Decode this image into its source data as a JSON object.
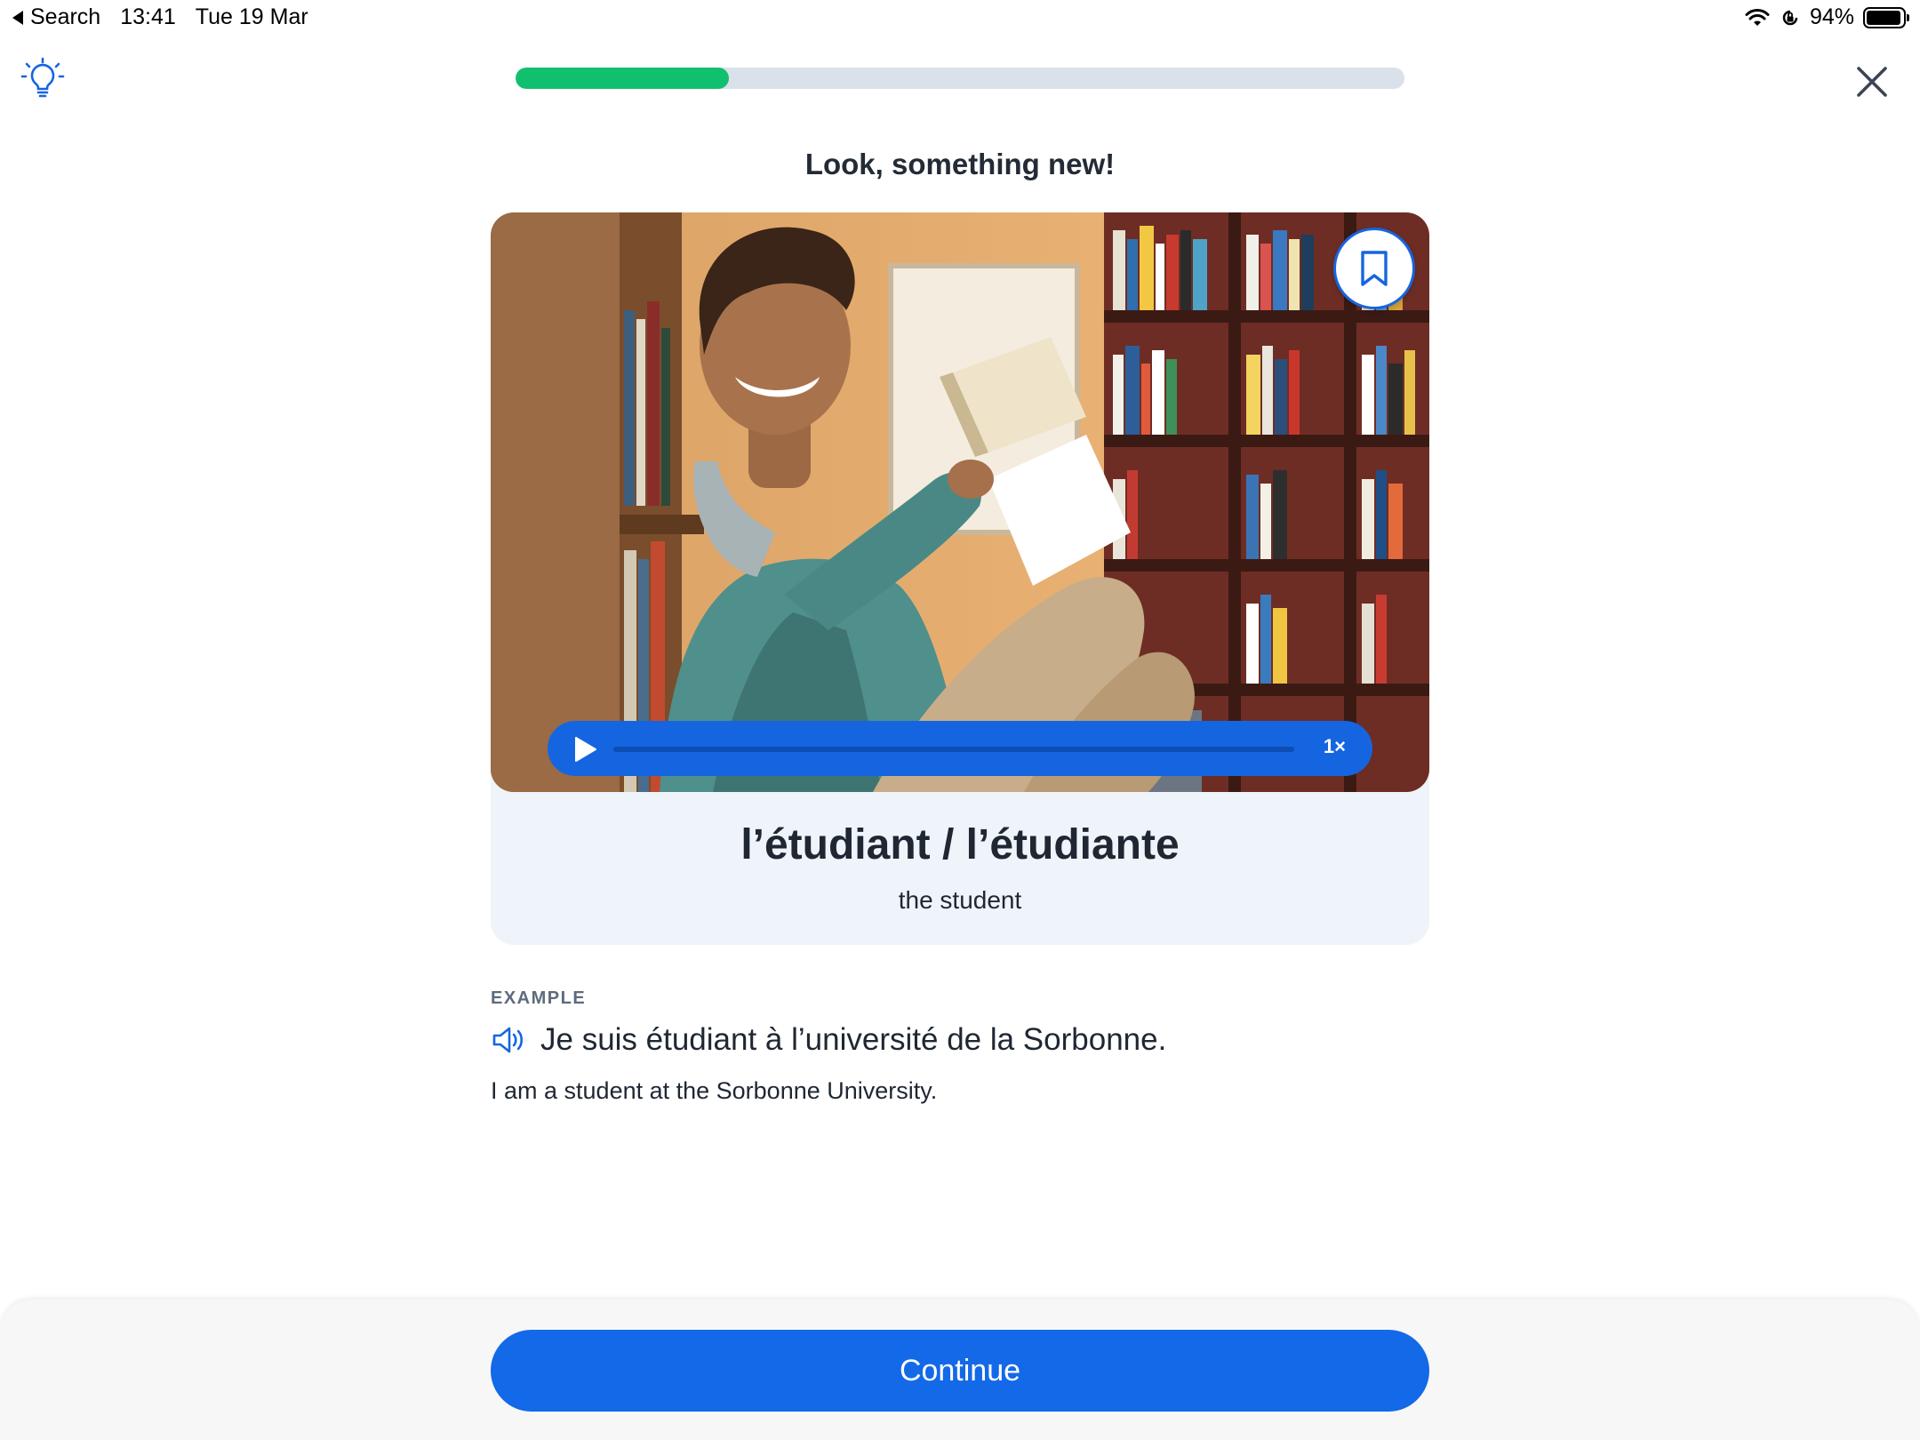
{
  "status_bar": {
    "back_label": "Search",
    "time": "13:41",
    "date": "Tue 19 Mar",
    "battery": "94%",
    "battery_level": 0.94
  },
  "lesson": {
    "progress": 0.24,
    "prompt": "Look, something new!"
  },
  "card": {
    "word": "l’étudiant / l’étudiante",
    "translation": "the student",
    "audio": {
      "speed": "1×",
      "position": 0.0
    }
  },
  "example": {
    "label": "EXAMPLE",
    "sentence": "Je suis étudiant à l’université de la Sorbonne.",
    "translation": "I am a student at the Sorbonne University."
  },
  "footer": {
    "continue_label": "Continue"
  },
  "icons": {
    "hint": "lightbulb-icon",
    "close": "close-icon",
    "bookmark": "bookmark-icon",
    "play": "play-icon",
    "speaker": "speaker-icon"
  },
  "colors": {
    "accent": "#1369e8",
    "progress": "#10c06f",
    "card_background": "#eff4fa"
  }
}
